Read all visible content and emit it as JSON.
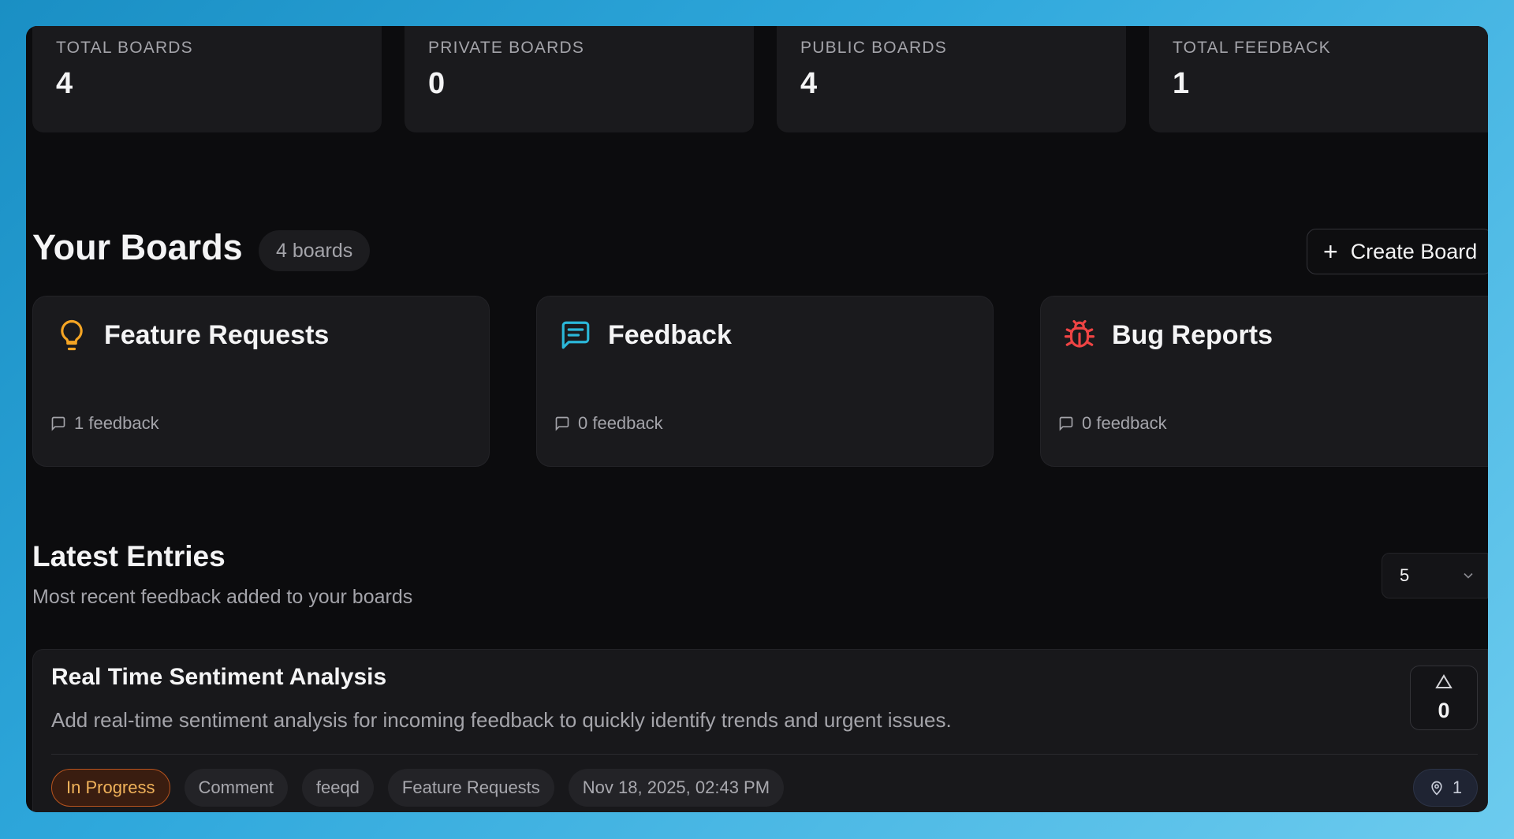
{
  "stats": [
    {
      "label": "TOTAL BOARDS",
      "value": "4"
    },
    {
      "label": "PRIVATE BOARDS",
      "value": "0"
    },
    {
      "label": "PUBLIC BOARDS",
      "value": "4"
    },
    {
      "label": "TOTAL FEEDBACK",
      "value": "1"
    }
  ],
  "boards_section": {
    "title": "Your Boards",
    "count": "4 boards",
    "create_label": "Create Board"
  },
  "boards": [
    {
      "name": "Feature Requests",
      "feedback": "1 feedback",
      "icon": "lightbulb-icon",
      "color": "#f5a524"
    },
    {
      "name": "Feedback",
      "feedback": "0 feedback",
      "icon": "message-square-icon",
      "color": "#2bb7d9"
    },
    {
      "name": "Bug Reports",
      "feedback": "0 feedback",
      "icon": "bug-icon",
      "color": "#ef4444"
    }
  ],
  "latest": {
    "title": "Latest Entries",
    "subtitle": "Most recent feedback added to your boards",
    "limit_value": "5"
  },
  "entry": {
    "title": "Real Time Sentiment Analysis",
    "description": "Add real-time sentiment analysis for incoming feedback to quickly identify trends and urgent issues.",
    "votes": "0",
    "status": "In Progress",
    "type": "Comment",
    "author": "feeqd",
    "board": "Feature Requests",
    "date": "Nov 18, 2025, 02:43 PM",
    "pin_count": "1"
  },
  "colors": {
    "accent_status": "#f0b25a",
    "background": "#0c0c0e",
    "card": "#1a1a1d"
  }
}
